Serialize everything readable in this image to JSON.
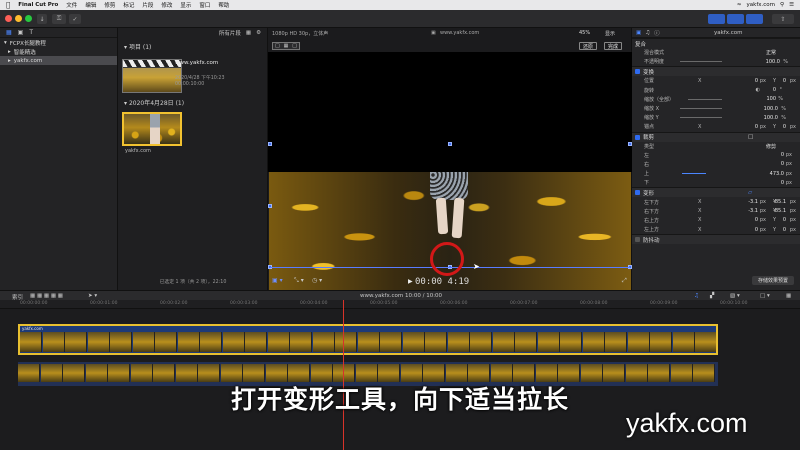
{
  "menubar": {
    "app": "Final Cut Pro",
    "items": [
      "文件",
      "编辑",
      "修剪",
      "标记",
      "片段",
      "修改",
      "显示",
      "窗口",
      "帮助"
    ],
    "right_text": "yakfx.com"
  },
  "sidebar": {
    "items": [
      {
        "label": "FCPX长腿教程",
        "selected": false
      },
      {
        "label": "智能精选",
        "selected": false
      },
      {
        "label": "yakfx.com",
        "selected": true
      }
    ]
  },
  "browser": {
    "filter": "所有片段",
    "section_projects": "项目",
    "section_projects_count": "(1)",
    "project": {
      "name": "www.yakfx.com",
      "date": "2020/4/28 下午10:23",
      "duration": "00:00:10:00"
    },
    "section_date": "2020年4月28日",
    "section_date_count": "(1)",
    "clip_name": "yakfx.com",
    "status": "已选定 1 项（共 2 项），22:10"
  },
  "viewer": {
    "format": "1080p HD 30p，立体声",
    "project_name": "www.yakfx.com",
    "zoom": "45%",
    "view_label": "显示",
    "reset_button": "还原",
    "done_button": "完成",
    "timecode": "00:00  4:19"
  },
  "inspector": {
    "title": "yakfx.com",
    "composite": {
      "header": "复合",
      "blend_label": "混合模式",
      "blend_value": "正常",
      "opacity_label": "不透明度",
      "opacity_value": "100.0",
      "opacity_unit": "%"
    },
    "transform": {
      "header": "变换",
      "rows": [
        {
          "label": "位置",
          "axis1": "X",
          "v1": "0",
          "u1": "px",
          "axis2": "Y",
          "v2": "0",
          "u2": "px"
        },
        {
          "label": "旋转",
          "v2": "0",
          "u2": "°"
        },
        {
          "label": "缩放（全部）",
          "v2": "100",
          "u2": "%"
        },
        {
          "label": "缩放 X",
          "v2": "100.0",
          "u2": "%"
        },
        {
          "label": "缩放 Y",
          "v2": "100.0",
          "u2": "%"
        },
        {
          "label": "锚点",
          "axis1": "X",
          "v1": "0",
          "u1": "px",
          "axis2": "Y",
          "v2": "0",
          "u2": "px"
        }
      ]
    },
    "crop": {
      "header": "裁剪",
      "type_label": "类型",
      "type_value": "修剪",
      "rows": [
        {
          "label": "左",
          "v": "0",
          "u": "px"
        },
        {
          "label": "右",
          "v": "0",
          "u": "px"
        },
        {
          "label": "上",
          "v": "473.0",
          "u": "px"
        },
        {
          "label": "下",
          "v": "0",
          "u": "px"
        }
      ]
    },
    "distort": {
      "header": "变形",
      "rows": [
        {
          "label": "左下方",
          "x": "-3.1",
          "y": "-85.1"
        },
        {
          "label": "右下方",
          "x": "-3.1",
          "y": "-85.1"
        },
        {
          "label": "右上方",
          "x": "0",
          "y": "0"
        },
        {
          "label": "左上方",
          "x": "0",
          "y": "0"
        }
      ]
    },
    "stabilize": {
      "header": "防抖动"
    },
    "save_button": "存储效果预置"
  },
  "timeline": {
    "index_label": "索引",
    "project": "www.yakfx.com",
    "duration": "10:00 / 10:00",
    "ruler": [
      "00:00:00:00",
      "00:00:01:00",
      "00:00:02:00",
      "00:00:03:00",
      "00:00:04:00",
      "00:00:05:00",
      "00:00:06:00",
      "00:00:07:00",
      "00:00:08:00",
      "00:00:09:00",
      "00:00:10:00"
    ],
    "clip_label": "yakfx.com"
  },
  "subtitle": "打开变形工具，向下适当拉长",
  "watermark": "yakfx.com",
  "colors": {
    "accent": "#2f6bf0",
    "annotation": "#d21818"
  }
}
